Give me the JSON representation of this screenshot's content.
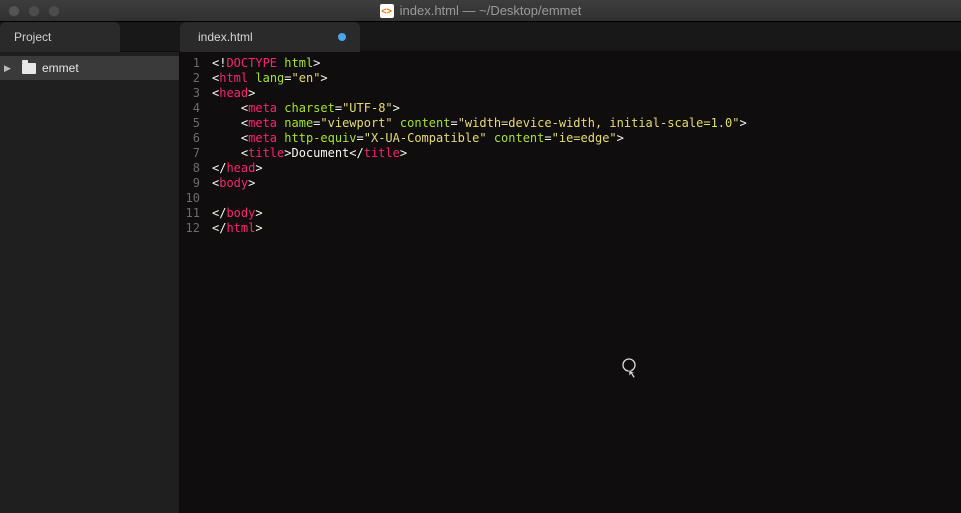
{
  "window": {
    "title": "index.html — ~/Desktop/emmet"
  },
  "sidebar": {
    "tab_label": "Project",
    "root_folder": "emmet"
  },
  "editor": {
    "tab_label": "index.html",
    "line_numbers": [
      "1",
      "2",
      "3",
      "4",
      "5",
      "6",
      "7",
      "8",
      "9",
      "10",
      "11",
      "12"
    ],
    "lines": [
      [
        {
          "t": "<!",
          "c": "c-white"
        },
        {
          "t": "DOCTYPE",
          "c": "c-tag"
        },
        {
          "t": " ",
          "c": ""
        },
        {
          "t": "html",
          "c": "c-attr"
        },
        {
          "t": ">",
          "c": "c-white"
        }
      ],
      [
        {
          "t": "<",
          "c": "c-white"
        },
        {
          "t": "html",
          "c": "c-tag"
        },
        {
          "t": " ",
          "c": ""
        },
        {
          "t": "lang",
          "c": "c-attr"
        },
        {
          "t": "=",
          "c": "c-white"
        },
        {
          "t": "\"en\"",
          "c": "c-str"
        },
        {
          "t": ">",
          "c": "c-white"
        }
      ],
      [
        {
          "t": "<",
          "c": "c-white"
        },
        {
          "t": "head",
          "c": "c-tag"
        },
        {
          "t": ">",
          "c": "c-white"
        }
      ],
      [
        {
          "t": "    <",
          "c": "c-white"
        },
        {
          "t": "meta",
          "c": "c-tag"
        },
        {
          "t": " ",
          "c": ""
        },
        {
          "t": "charset",
          "c": "c-attr"
        },
        {
          "t": "=",
          "c": "c-white"
        },
        {
          "t": "\"UTF-8\"",
          "c": "c-str"
        },
        {
          "t": ">",
          "c": "c-white"
        }
      ],
      [
        {
          "t": "    <",
          "c": "c-white"
        },
        {
          "t": "meta",
          "c": "c-tag"
        },
        {
          "t": " ",
          "c": ""
        },
        {
          "t": "name",
          "c": "c-attr"
        },
        {
          "t": "=",
          "c": "c-white"
        },
        {
          "t": "\"viewport\"",
          "c": "c-str"
        },
        {
          "t": " ",
          "c": ""
        },
        {
          "t": "content",
          "c": "c-attr"
        },
        {
          "t": "=",
          "c": "c-white"
        },
        {
          "t": "\"width=device-width, initial-scale=1.0\"",
          "c": "c-str"
        },
        {
          "t": ">",
          "c": "c-white"
        }
      ],
      [
        {
          "t": "    <",
          "c": "c-white"
        },
        {
          "t": "meta",
          "c": "c-tag"
        },
        {
          "t": " ",
          "c": ""
        },
        {
          "t": "http-equiv",
          "c": "c-attr"
        },
        {
          "t": "=",
          "c": "c-white"
        },
        {
          "t": "\"X-UA-Compatible\"",
          "c": "c-str"
        },
        {
          "t": " ",
          "c": ""
        },
        {
          "t": "content",
          "c": "c-attr"
        },
        {
          "t": "=",
          "c": "c-white"
        },
        {
          "t": "\"ie=edge\"",
          "c": "c-str"
        },
        {
          "t": ">",
          "c": "c-white"
        }
      ],
      [
        {
          "t": "    <",
          "c": "c-white"
        },
        {
          "t": "title",
          "c": "c-tag"
        },
        {
          "t": ">",
          "c": "c-white"
        },
        {
          "t": "Document",
          "c": "c-white"
        },
        {
          "t": "</",
          "c": "c-white"
        },
        {
          "t": "title",
          "c": "c-tag"
        },
        {
          "t": ">",
          "c": "c-white"
        }
      ],
      [
        {
          "t": "</",
          "c": "c-white"
        },
        {
          "t": "head",
          "c": "c-tag"
        },
        {
          "t": ">",
          "c": "c-white"
        }
      ],
      [
        {
          "t": "<",
          "c": "c-white"
        },
        {
          "t": "body",
          "c": "c-tag"
        },
        {
          "t": ">",
          "c": "c-white"
        }
      ],
      [
        {
          "t": "    ",
          "c": ""
        }
      ],
      [
        {
          "t": "</",
          "c": "c-white"
        },
        {
          "t": "body",
          "c": "c-tag"
        },
        {
          "t": ">",
          "c": "c-white"
        }
      ],
      [
        {
          "t": "</",
          "c": "c-white"
        },
        {
          "t": "html",
          "c": "c-tag"
        },
        {
          "t": ">",
          "c": "c-white"
        }
      ]
    ]
  }
}
